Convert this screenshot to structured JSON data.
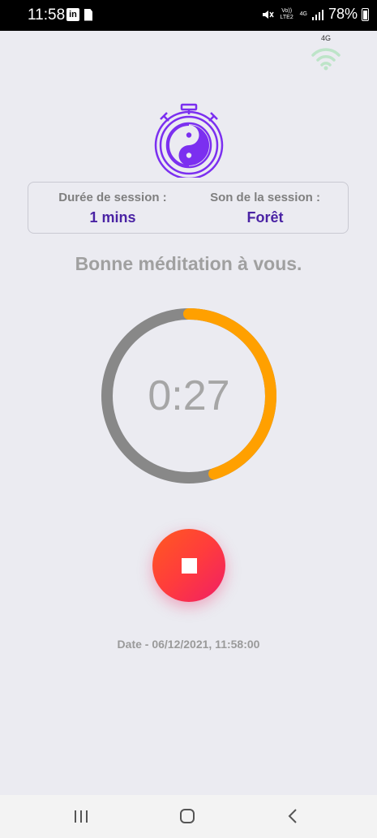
{
  "status_bar": {
    "time": "11:58",
    "linkedin_label": "in",
    "battery": "78%",
    "volte": "Vo)) LTE2",
    "network_small": "4G"
  },
  "wifi": {
    "label": "4G"
  },
  "session": {
    "duration_label": "Durée de session :",
    "duration_value": "1 mins",
    "sound_label": "Son de la session :",
    "sound_value": "Forêt"
  },
  "greeting": "Bonne méditation à vous.",
  "timer": {
    "display": "0:27",
    "progress_fraction": 0.45
  },
  "date_line": "Date - 06/12/2021, 11:58:00",
  "colors": {
    "accent_purple": "#7b2ff0",
    "value_purple": "#4a23a4",
    "ring_track": "#888888",
    "ring_progress": "#ffa000",
    "stop_gradient_start": "#ff5a20",
    "stop_gradient_end": "#f01f66"
  },
  "icons": {
    "status_linkedin": "linkedin-icon",
    "status_sim": "sim-card-icon",
    "status_mute": "mute-icon",
    "status_signal": "signal-icon",
    "status_battery": "battery-icon",
    "wifi": "wifi-icon",
    "stopwatch": "yin-yang-stopwatch-icon",
    "stop": "stop-icon",
    "nav_recents": "recent-apps-icon",
    "nav_home": "home-icon",
    "nav_back": "back-icon"
  }
}
